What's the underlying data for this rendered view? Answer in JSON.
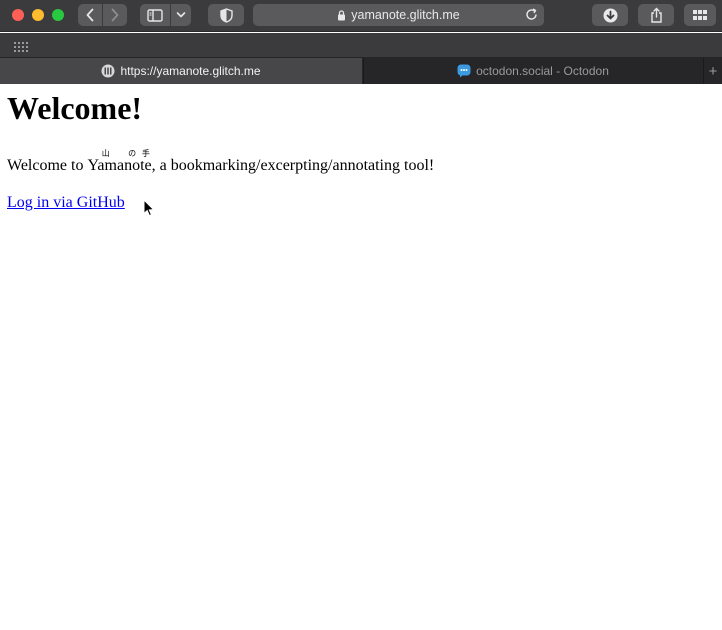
{
  "browser": {
    "address_bar": {
      "url": "yamanote.glitch.me"
    },
    "tabs": [
      {
        "label": "https://yamanote.glitch.me",
        "active": true,
        "icon": "yamanote-favicon"
      },
      {
        "label": "octodon.social - Octodon",
        "active": false,
        "icon": "mastodon-favicon"
      }
    ],
    "new_tab_label": "+"
  },
  "page": {
    "title": "Welcome!",
    "intro": {
      "before": "Welcome to ",
      "ruby": [
        {
          "base": "Yama",
          "annotation": "山"
        },
        {
          "base": "no",
          "annotation": "の"
        },
        {
          "base": "te",
          "annotation": "手"
        }
      ],
      "after": ", a bookmarking/excerpting/annotating tool!"
    },
    "login_link": "Log in via GitHub"
  },
  "colors": {
    "chrome_bg": "#3b3b3d",
    "link": "#0000ee",
    "traffic_close": "#fe5f57",
    "traffic_min": "#febc2e",
    "traffic_max": "#28c840"
  }
}
